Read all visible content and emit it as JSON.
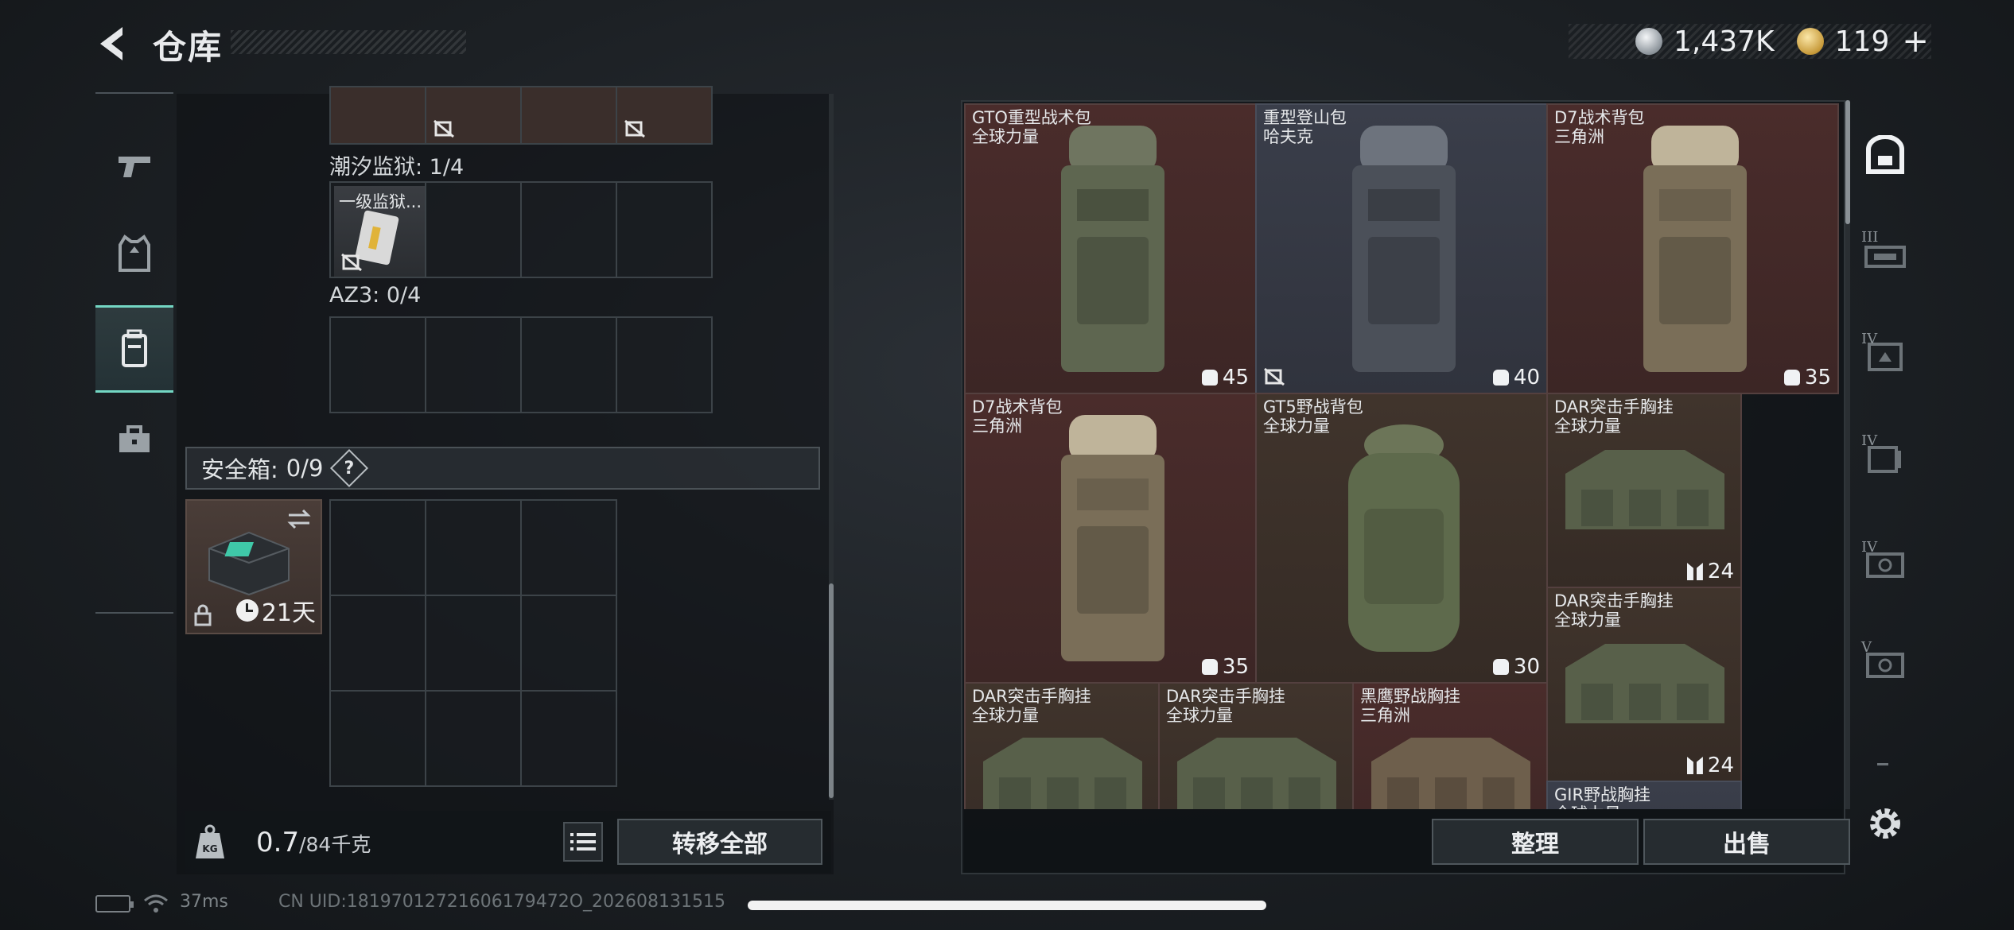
{
  "header": {
    "title": "仓库",
    "currency_silver": "1,437K",
    "currency_gold": "119",
    "plus_label": "+"
  },
  "left_panel": {
    "tidal_prison_label": "潮汐监狱: 1/4",
    "tidal_item_name": "一级监狱...",
    "az3_label": "AZ3: 0/4",
    "safe_box_label": "安全箱:",
    "safe_box_count": "0/9",
    "help_label": "?",
    "safe_box_days": "21天",
    "weight_current": "0.7",
    "weight_max": "/84千克",
    "transfer_all_label": "转移全部"
  },
  "inventory": {
    "items": [
      {
        "name": "GTO重型战术包\n全球力量",
        "count": "45",
        "icon": "capacity-icon",
        "no_trade": false
      },
      {
        "name": "重型登山包\n哈夫克",
        "count": "40",
        "icon": "capacity-icon",
        "no_trade": true
      },
      {
        "name": "D7战术背包\n三角洲",
        "count": "35",
        "icon": "capacity-icon",
        "no_trade": false
      },
      {
        "name": "D7战术背包\n三角洲",
        "count": "35",
        "icon": "capacity-icon",
        "no_trade": false
      },
      {
        "name": "GT5野战背包\n全球力量",
        "count": "30",
        "icon": "capacity-icon",
        "no_trade": false
      },
      {
        "name": "DAR突击手胸挂\n全球力量",
        "count": "24",
        "icon": "vest-icon",
        "no_trade": false
      },
      {
        "name": "DAR突击手胸挂\n全球力量",
        "count": "24",
        "icon": "vest-icon",
        "no_trade": false
      },
      {
        "name": "DAR突击手胸挂\n全球力量",
        "count": "",
        "icon": "vest-icon",
        "no_trade": false
      },
      {
        "name": "DAR突击手胸挂\n全球力量",
        "count": "",
        "icon": "vest-icon",
        "no_trade": false
      },
      {
        "name": "黑鹰野战胸挂\n三角洲",
        "count": "",
        "icon": "vest-icon",
        "no_trade": false
      },
      {
        "name": "GIR野战胸挂\n全球力量",
        "count": "",
        "icon": "vest-icon",
        "no_trade": false
      }
    ],
    "organize_label": "整理",
    "sell_label": "出售"
  },
  "filter_rail": {
    "tiers": [
      "III",
      "IV",
      "IV",
      "IV",
      "V"
    ]
  },
  "status_bar": {
    "ping": "37ms",
    "uid": "CN UID:18197012721606179472O_202608131515"
  },
  "colors": {
    "accent": "#73d6c3",
    "item_red": "#4a2c2b",
    "item_brown": "#40342c"
  }
}
